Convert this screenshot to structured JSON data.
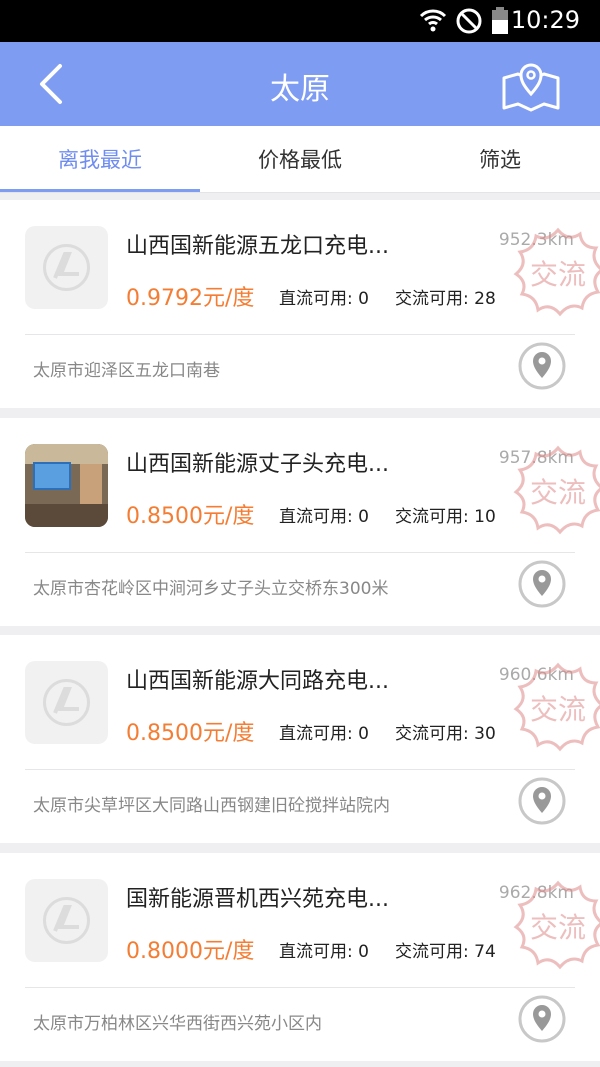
{
  "status": {
    "time": "10:29"
  },
  "header": {
    "title": "太原"
  },
  "tabs": [
    {
      "label": "离我最近",
      "active": true
    },
    {
      "label": "价格最低",
      "active": false
    },
    {
      "label": "筛选",
      "active": false
    }
  ],
  "stamp_text": "交流",
  "stations": [
    {
      "name": "山西国新能源五龙口充电...",
      "distance": "952.3km",
      "price": "0.9792元/度",
      "dc": "直流可用: 0",
      "ac": "交流可用: 28",
      "address": "太原市迎泽区五龙口南巷",
      "thumb": "logo"
    },
    {
      "name": "山西国新能源丈子头充电...",
      "distance": "957.8km",
      "price": "0.8500元/度",
      "dc": "直流可用: 0",
      "ac": "交流可用: 10",
      "address": "太原市杏花岭区中涧河乡丈子头立交桥东300米",
      "thumb": "photo"
    },
    {
      "name": "山西国新能源大同路充电...",
      "distance": "960.6km",
      "price": "0.8500元/度",
      "dc": "直流可用: 0",
      "ac": "交流可用: 30",
      "address": "太原市尖草坪区大同路山西钢建旧砼搅拌站院内",
      "thumb": "logo"
    },
    {
      "name": "国新能源晋机西兴苑充电...",
      "distance": "962.8km",
      "price": "0.8000元/度",
      "dc": "直流可用: 0",
      "ac": "交流可用: 74",
      "address": "太原市万柏林区兴华西街西兴苑小区内",
      "thumb": "logo"
    }
  ],
  "colors": {
    "accent": "#7f9cf3",
    "price": "#f47d33"
  }
}
